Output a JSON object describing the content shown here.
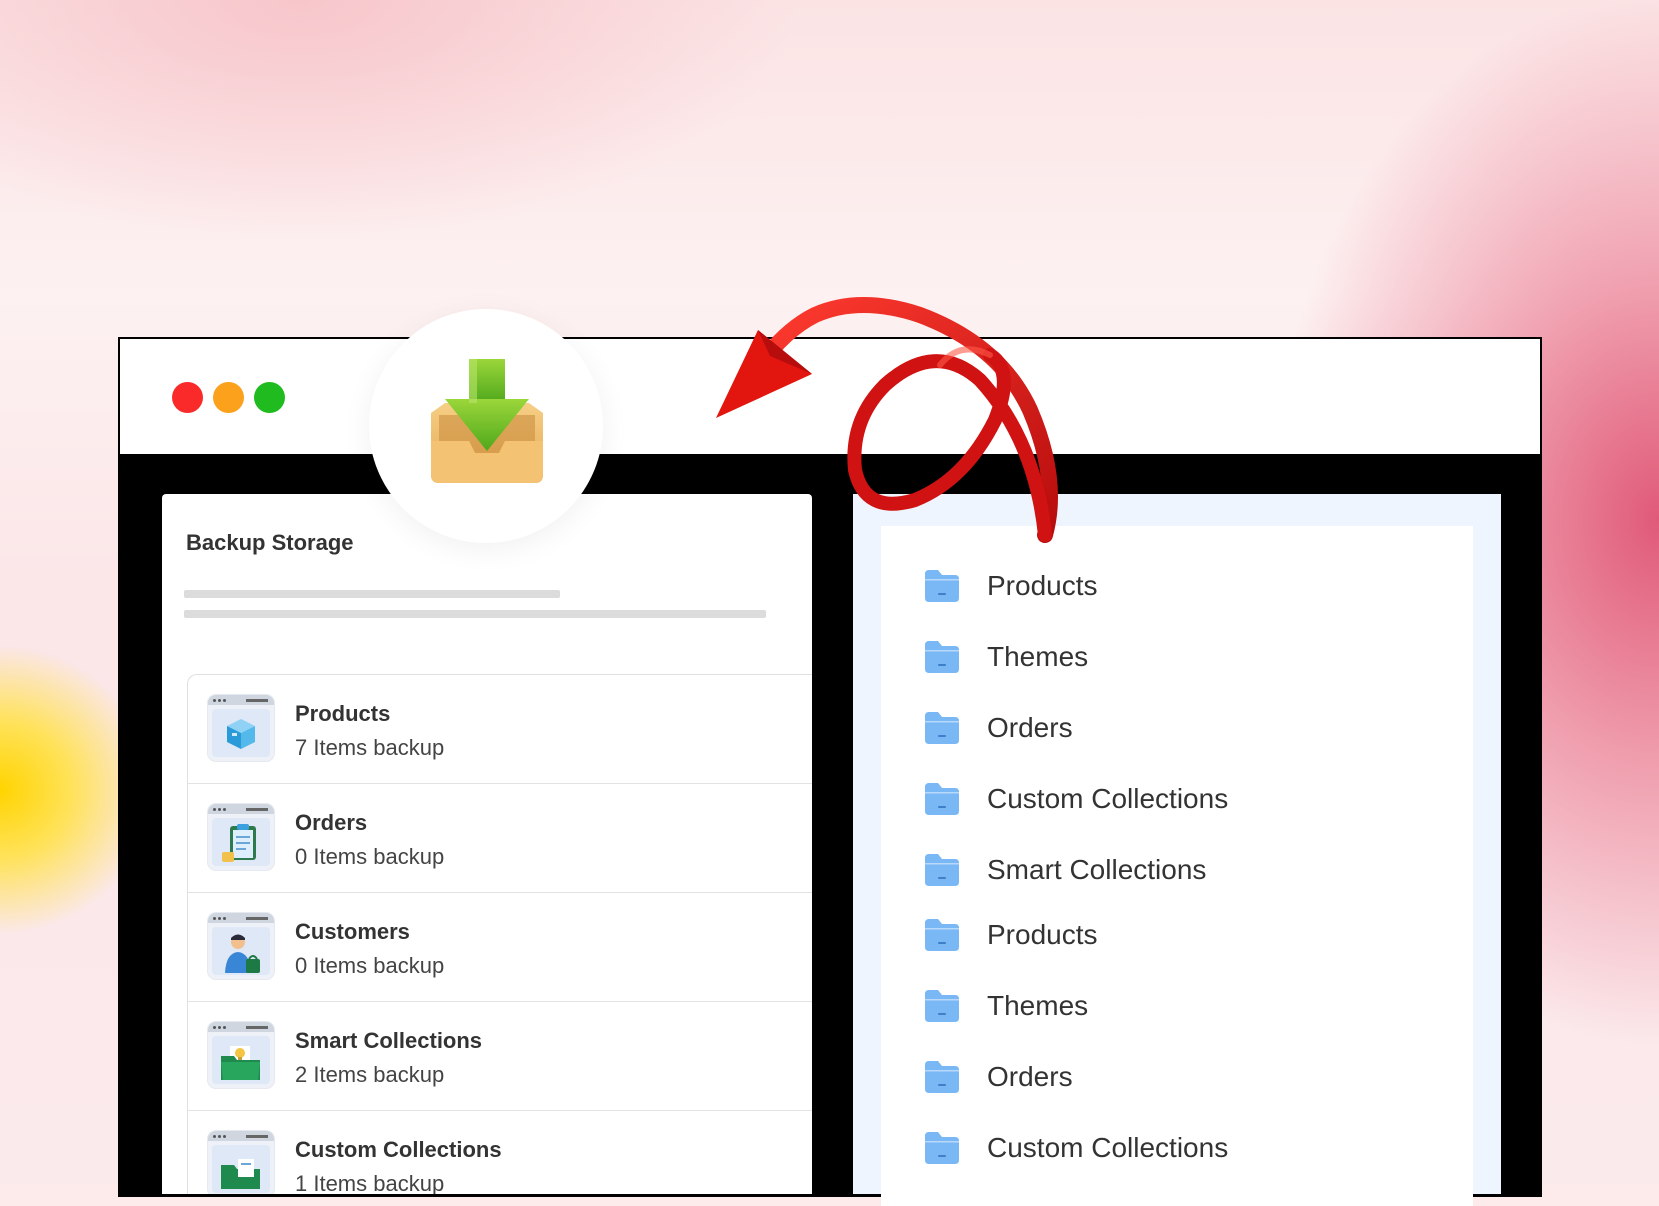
{
  "window": {
    "controls": [
      "close",
      "minimize",
      "maximize"
    ],
    "colors": {
      "close": "#fb2a2a",
      "minimize": "#fba11c",
      "maximize": "#1fbb1f"
    }
  },
  "left_panel": {
    "title": "Backup Storage",
    "items": [
      {
        "title": "Products",
        "subtitle": "7 Items backup",
        "icon": "product-box-icon"
      },
      {
        "title": "Orders",
        "subtitle": "0 Items backup",
        "icon": "order-clipboard-icon"
      },
      {
        "title": "Customers",
        "subtitle": "0 Items backup",
        "icon": "customer-person-icon"
      },
      {
        "title": "Smart Collections",
        "subtitle": "2 Items backup",
        "icon": "smart-collection-folder-icon"
      },
      {
        "title": "Custom Collections",
        "subtitle": "1 Items backup",
        "icon": "custom-collection-icon"
      }
    ]
  },
  "right_panel": {
    "folders": [
      {
        "label": "Products"
      },
      {
        "label": "Themes"
      },
      {
        "label": "Orders"
      },
      {
        "label": "Custom Collections"
      },
      {
        "label": "Smart Collections"
      },
      {
        "label": "Products"
      },
      {
        "label": "Themes"
      },
      {
        "label": "Orders"
      },
      {
        "label": "Custom Collections"
      }
    ],
    "folder_color": "#7ab8f5"
  },
  "decor": {
    "download_icon": "download-inbox-icon",
    "arrow": "curved-red-arrow-icon",
    "arrow_color": "#e3150f"
  }
}
